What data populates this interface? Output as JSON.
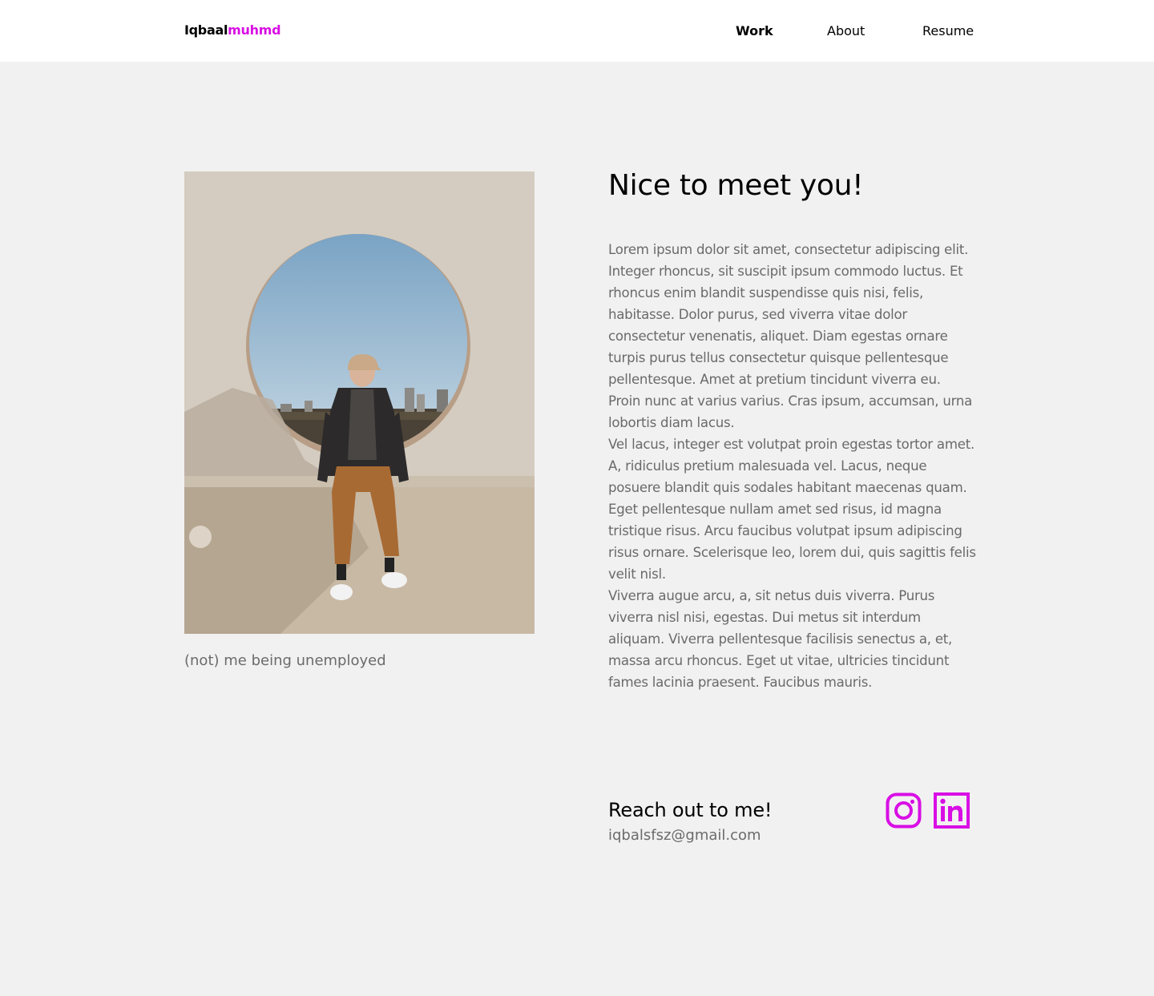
{
  "header": {
    "logo_part1": "Iqbaal",
    "logo_part2": "muhmd",
    "nav": {
      "work": "Work",
      "about": "About",
      "resume": "Resume"
    },
    "active_nav": "Work"
  },
  "photo": {
    "caption": "(not) me being unemployed"
  },
  "about": {
    "heading": "Nice to meet you!",
    "paragraphs": [
      "Lorem ipsum dolor sit amet, consectetur adipiscing elit. Integer rhoncus, sit suscipit ipsum commodo luctus. Et rhoncus enim blandit suspendisse quis nisi, felis, habitasse. Dolor purus, sed viverra vitae dolor consectetur venenatis, aliquet. Diam egestas ornare turpis purus tellus consectetur quisque pellentesque pellentesque. Amet at pretium tincidunt viverra eu. Proin nunc at varius varius. Cras ipsum, accumsan, urna lobortis diam lacus.",
      "Vel lacus, integer est volutpat proin egestas tortor amet. A, ridiculus pretium malesuada vel. Lacus, neque posuere blandit quis sodales habitant maecenas quam. Eget pellentesque nullam amet sed risus, id magna tristique risus. Arcu faucibus volutpat ipsum adipiscing risus ornare. Scelerisque leo, lorem dui, quis sagittis felis velit nisl.",
      "Viverra augue arcu, a, sit netus duis viverra. Purus viverra nisl nisi, egestas. Dui metus sit interdum aliquam. Viverra pellentesque facilisis senectus a, et, massa arcu rhoncus. Eget ut vitae, ultricies tincidunt fames lacinia praesent. Faucibus mauris."
    ]
  },
  "contact": {
    "title": "Reach out to me!",
    "email": "iqbalsfsz@gmail.com",
    "icons": [
      "instagram-icon",
      "linkedin-icon"
    ]
  },
  "colors": {
    "accent": "#d90ee5",
    "background": "#f1f1f1",
    "header_bg": "#ffffff",
    "body_text": "#6a6a6a"
  }
}
